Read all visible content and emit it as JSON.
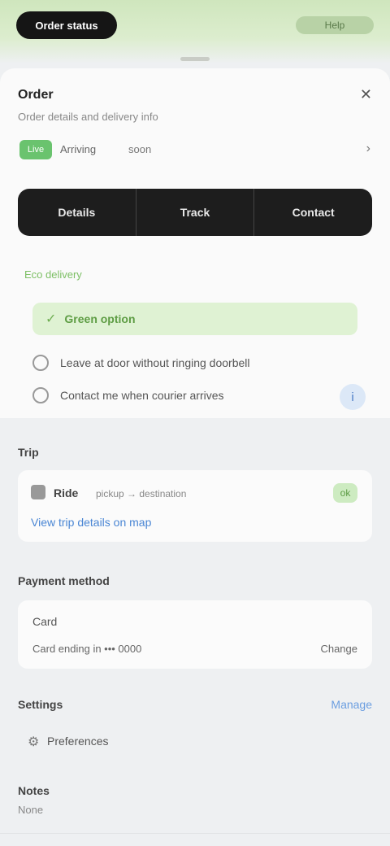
{
  "top": {
    "pill_label": "Order status",
    "right_label": "Help"
  },
  "order": {
    "title": "Order",
    "close": "✕",
    "subtitle": "Order details and delivery info",
    "status": {
      "badge": "Live",
      "text": "Arriving",
      "time": "soon",
      "chevron": "›"
    }
  },
  "segments": [
    "Details",
    "Track",
    "Contact"
  ],
  "promo": {
    "label": "Eco delivery",
    "icon": "✓",
    "text": "Green option"
  },
  "checks": [
    {
      "label": "Leave at door without ringing doorbell"
    },
    {
      "label": "Contact me when courier arrives"
    }
  ],
  "info_icon": "i",
  "trip": {
    "section_title": "Trip",
    "name": "Ride",
    "detail": "pickup → destination",
    "badge": "ok",
    "link": "View trip details on map"
  },
  "payment": {
    "section_title": "Payment method",
    "method": "Card",
    "amount_label": "Card ending in ••• 0000",
    "right_label": "Change"
  },
  "settings": {
    "section_title": "Settings",
    "manage_link": "Manage",
    "gear_icon": "⚙",
    "pref_label": "Preferences"
  },
  "notes": {
    "title": "Notes",
    "subtitle": "None"
  }
}
